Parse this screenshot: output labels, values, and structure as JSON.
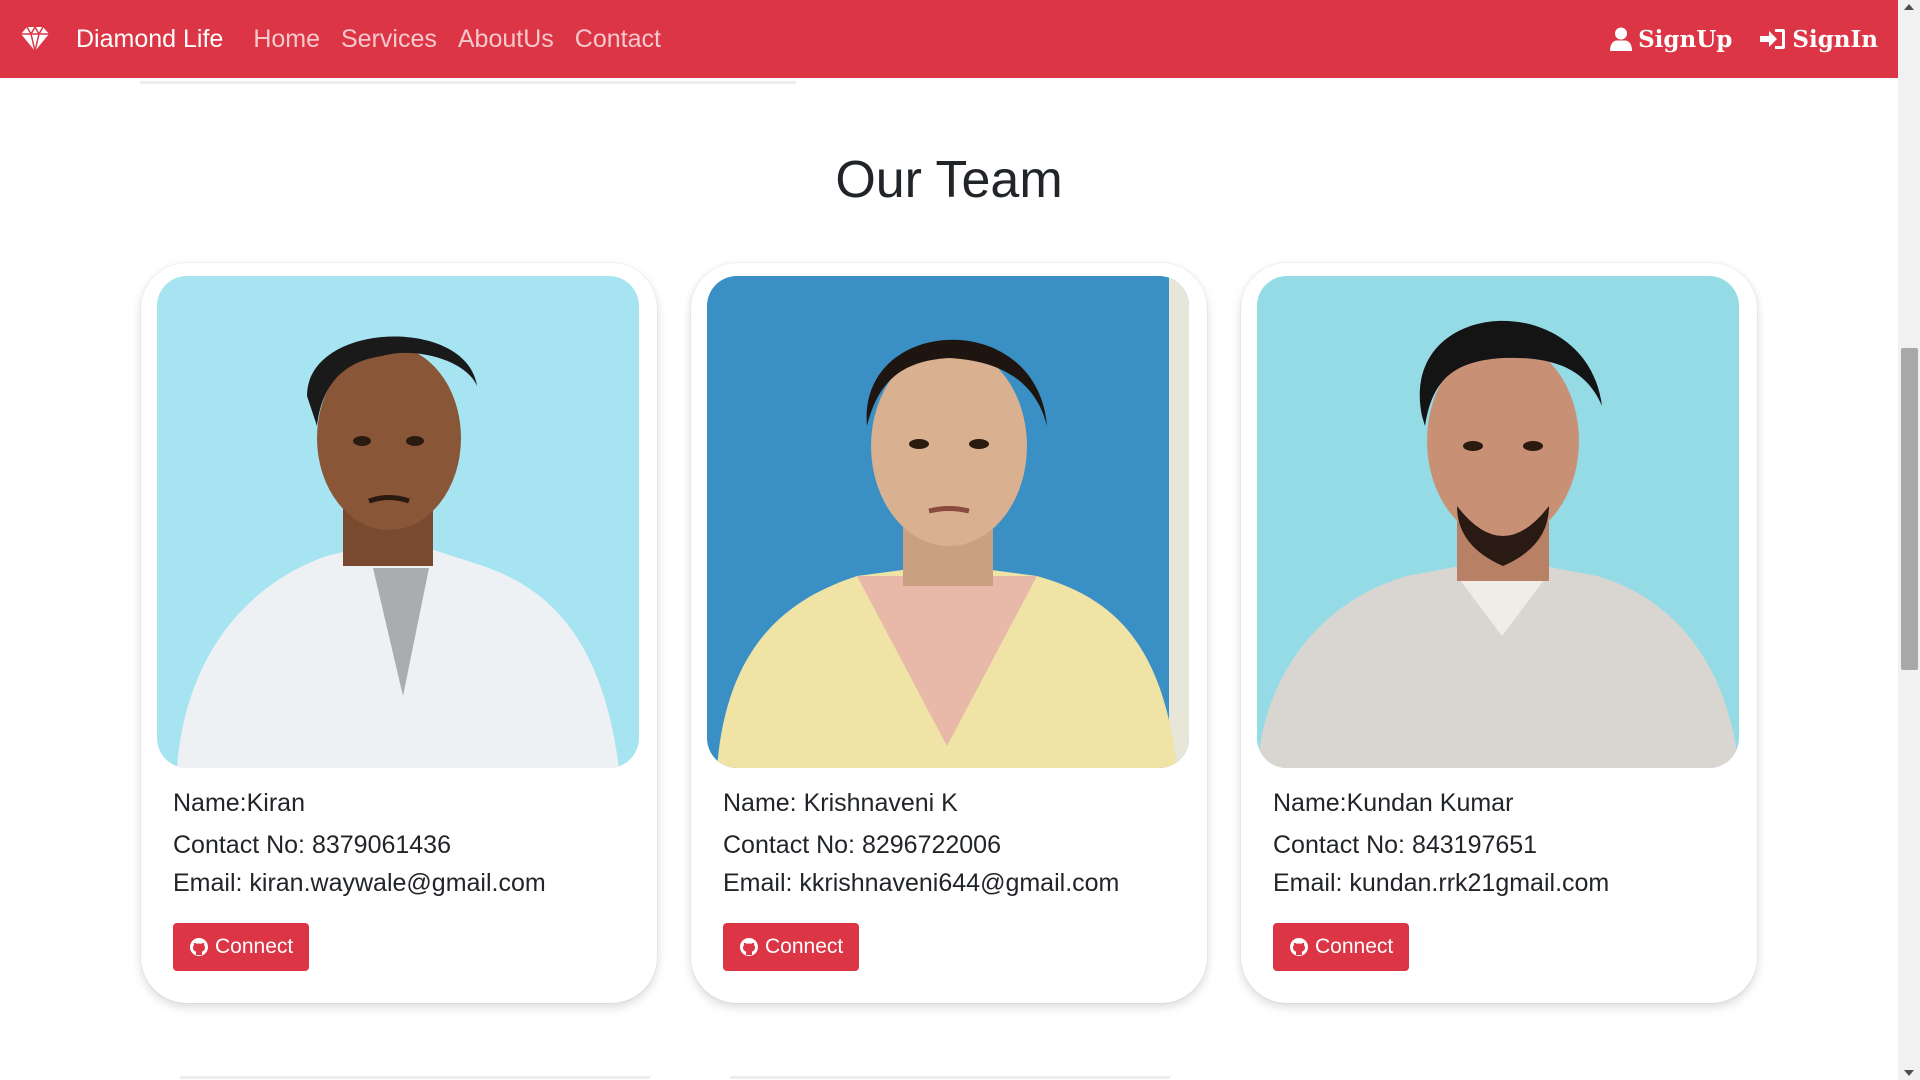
{
  "navbar": {
    "brand": "Diamond Life",
    "links": [
      "Home",
      "Services",
      "AboutUs",
      "Contact"
    ],
    "signup": "SignUp",
    "signin": "SignIn",
    "color": "#dc3545"
  },
  "section": {
    "title": "Our Team"
  },
  "team": [
    {
      "name": "Name:Kiran",
      "contact": "Contact No: 8379061436",
      "email": "Email: kiran.waywale@gmail.com",
      "button": "Connect",
      "photo_bg": "#a6e4f2"
    },
    {
      "name": "Name: Krishnaveni K",
      "contact": "Contact No: 8296722006",
      "email": "Email: kkrishnaveni644@gmail.com",
      "button": "Connect",
      "photo_bg": "#3a8fc4"
    },
    {
      "name": "Name:Kundan Kumar",
      "contact": "Contact No: 843197651",
      "email": "Email: kundan.rrk21gmail.com",
      "button": "Connect",
      "photo_bg": "#95dbe6"
    }
  ],
  "icons": {
    "brand": "diamond-icon",
    "signup": "user-icon",
    "signin": "sign-in-icon",
    "connect": "github-icon"
  }
}
